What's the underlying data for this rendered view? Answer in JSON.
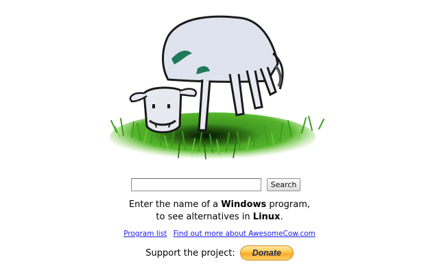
{
  "hero": {
    "illustration": "grazing-cow-drawing",
    "colors": {
      "grass": "#3a9a1f",
      "cow_spots": "#1f7a5a",
      "outline": "#1a1a1a"
    }
  },
  "search": {
    "input_value": "",
    "input_placeholder": "",
    "button_label": "Search"
  },
  "tagline": {
    "line1_prefix": "Enter the name of a ",
    "line1_bold": "Windows",
    "line1_suffix": " program,",
    "line2_prefix": "to see alternatives in ",
    "line2_bold": "Linux",
    "line2_suffix": "."
  },
  "links": {
    "program_list": "Program list",
    "about": "Find out more about AwesomeCow.com",
    "color": "#1a1ae6"
  },
  "support": {
    "label": "Support the project:",
    "donate_label": "Donate"
  }
}
